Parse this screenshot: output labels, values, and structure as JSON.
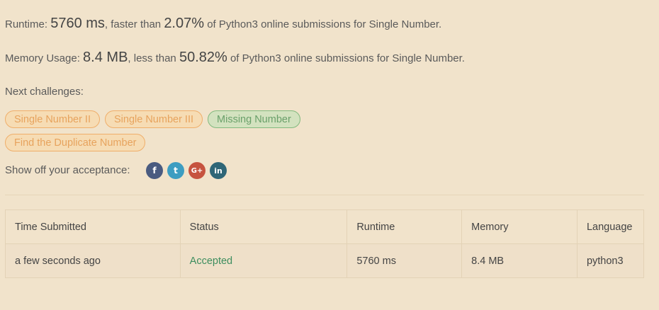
{
  "runtime": {
    "label": "Runtime: ",
    "value": "5760 ms",
    "mid": ", faster than ",
    "percent": "2.07%",
    "suffix": " of Python3 online submissions for Single Number."
  },
  "memory": {
    "label": "Memory Usage: ",
    "value": "8.4 MB",
    "mid": ", less than ",
    "percent": "50.82%",
    "suffix": " of Python3 online submissions for Single Number."
  },
  "next_challenges": {
    "label": "Next challenges:",
    "items": [
      {
        "label": "Single Number II",
        "difficulty": "medium"
      },
      {
        "label": "Single Number III",
        "difficulty": "medium"
      },
      {
        "label": "Missing Number",
        "difficulty": "easy"
      },
      {
        "label": "Find the Duplicate Number",
        "difficulty": "medium"
      }
    ]
  },
  "share": {
    "label": "Show off your acceptance:",
    "icons": [
      {
        "name": "facebook-icon",
        "glyph": "f",
        "color": "#4a5b80"
      },
      {
        "name": "twitter-icon",
        "glyph": "t",
        "color": "#3d9dc1"
      },
      {
        "name": "google-plus-icon",
        "glyph": "G+",
        "color": "#c6533f"
      },
      {
        "name": "linkedin-icon",
        "glyph": "in",
        "color": "#2f6677"
      }
    ]
  },
  "table": {
    "headers": [
      "Time Submitted",
      "Status",
      "Runtime",
      "Memory",
      "Language"
    ],
    "rows": [
      [
        "a few seconds ago",
        "Accepted",
        "5760 ms",
        "8.4 MB",
        "python3"
      ]
    ]
  },
  "colors": {
    "background": "#f1e3cb",
    "medium_tag_text": "#e7a35d",
    "easy_tag_text": "#6aa06a",
    "accepted": "#3c8d5e"
  }
}
